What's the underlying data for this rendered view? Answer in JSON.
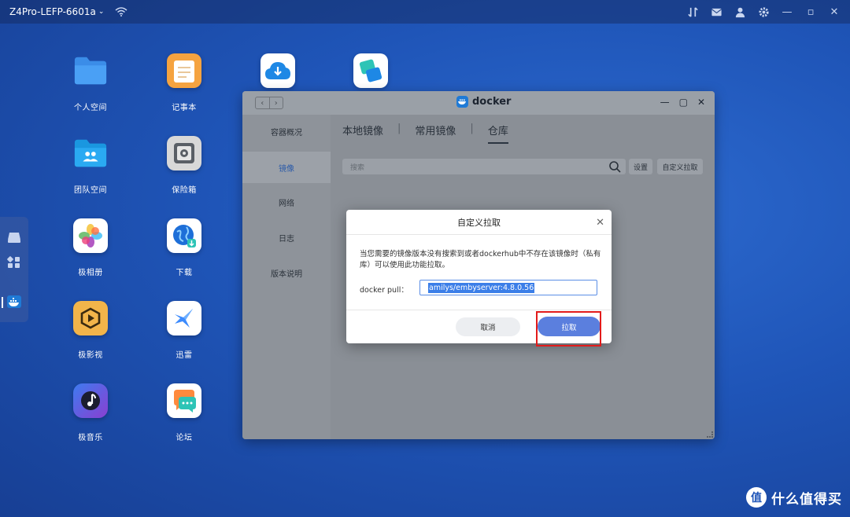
{
  "topbar": {
    "device_name": "Z4Pro-LEFP-6601a",
    "icons": [
      "transfer-icon",
      "mail-icon",
      "user-icon",
      "gear-icon",
      "minimize-icon",
      "maximize-icon",
      "close-icon"
    ]
  },
  "desktop": {
    "apps": [
      {
        "label": "个人空间",
        "icon": "folder-icon",
        "color": "#3b8de8"
      },
      {
        "label": "记事本",
        "icon": "notepad-icon",
        "color": "#f5a340"
      },
      {
        "label": "",
        "icon": "cloud-download-icon",
        "color": "#ffffff"
      },
      {
        "label": "",
        "icon": "sync-icon",
        "color": "#ffffff"
      },
      {
        "label": "团队空间",
        "icon": "team-folder-icon",
        "color": "#2aa8f0"
      },
      {
        "label": "保险箱",
        "icon": "safe-icon",
        "color": "#d8d8d8"
      },
      {
        "label": "极相册",
        "icon": "photos-icon",
        "color": "#ffffff"
      },
      {
        "label": "下载",
        "icon": "download-globe-icon",
        "color": "#ffffff"
      },
      {
        "label": "极影视",
        "icon": "video-icon",
        "color": "#f2b44a"
      },
      {
        "label": "迅雷",
        "icon": "thunder-icon",
        "color": "#ffffff"
      },
      {
        "label": "极音乐",
        "icon": "music-icon",
        "color": "#5c4fd8"
      },
      {
        "label": "论坛",
        "icon": "forum-icon",
        "color": "#ffffff"
      }
    ]
  },
  "dock": {
    "icons": [
      "drive-icon",
      "apps-grid-icon",
      "docker-icon"
    ]
  },
  "docker_window": {
    "title": "docker",
    "sidebar": [
      {
        "label": "容器概况"
      },
      {
        "label": "镜像"
      },
      {
        "label": "网络"
      },
      {
        "label": "日志"
      },
      {
        "label": "版本说明"
      }
    ],
    "tabs": [
      {
        "label": "本地镜像"
      },
      {
        "label": "常用镜像"
      },
      {
        "label": "仓库"
      }
    ],
    "search": {
      "placeholder": "搜索"
    },
    "buttons": {
      "settings": "设置",
      "custom_pull": "自定义拉取"
    }
  },
  "dialog": {
    "title": "自定义拉取",
    "message": "当您需要的镜像版本没有搜索到或者dockerhub中不存在该镜像时（私有库）可以使用此功能拉取。",
    "input_label": "docker pull：",
    "input_value": "amilys/embyserver:4.8.0.56",
    "cancel_label": "取消",
    "ok_label": "拉取"
  },
  "watermark": {
    "logo_char": "值",
    "text": "什么值得买"
  }
}
